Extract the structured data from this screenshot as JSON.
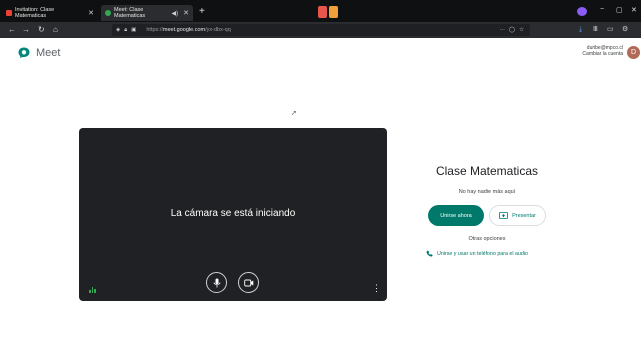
{
  "browser": {
    "tabs": [
      {
        "label": "Invitation: Clase Matematicas",
        "close": "✕"
      },
      {
        "label": "Meet: Clase Matematicas",
        "close": "✕"
      }
    ],
    "new_tab": "+",
    "url_prefix": "https://",
    "url_host": "meet.google.com",
    "url_path": "/yx-dbx-qq",
    "window_controls": [
      "−",
      "▢",
      "✕"
    ],
    "colors": {
      "chrome": "#0f1011",
      "toolbar": "#2b2c2f"
    }
  },
  "app": {
    "name": "Meet",
    "account_email": "duribe@mpco.cl",
    "account_switch": "Cambiar la cuenta",
    "avatar_letter": "D"
  },
  "preview": {
    "status_text": "La cámara se está iniciando"
  },
  "panel": {
    "meeting_title": "Clase Matematicas",
    "status": "No hay nadie más aquí",
    "join_label": "Unirse ahora",
    "present_label": "Presentar",
    "other_options": "Otras opciones",
    "phone_option": "Unirse y usar un teléfono para el audio",
    "accent_color": "#00796b"
  }
}
